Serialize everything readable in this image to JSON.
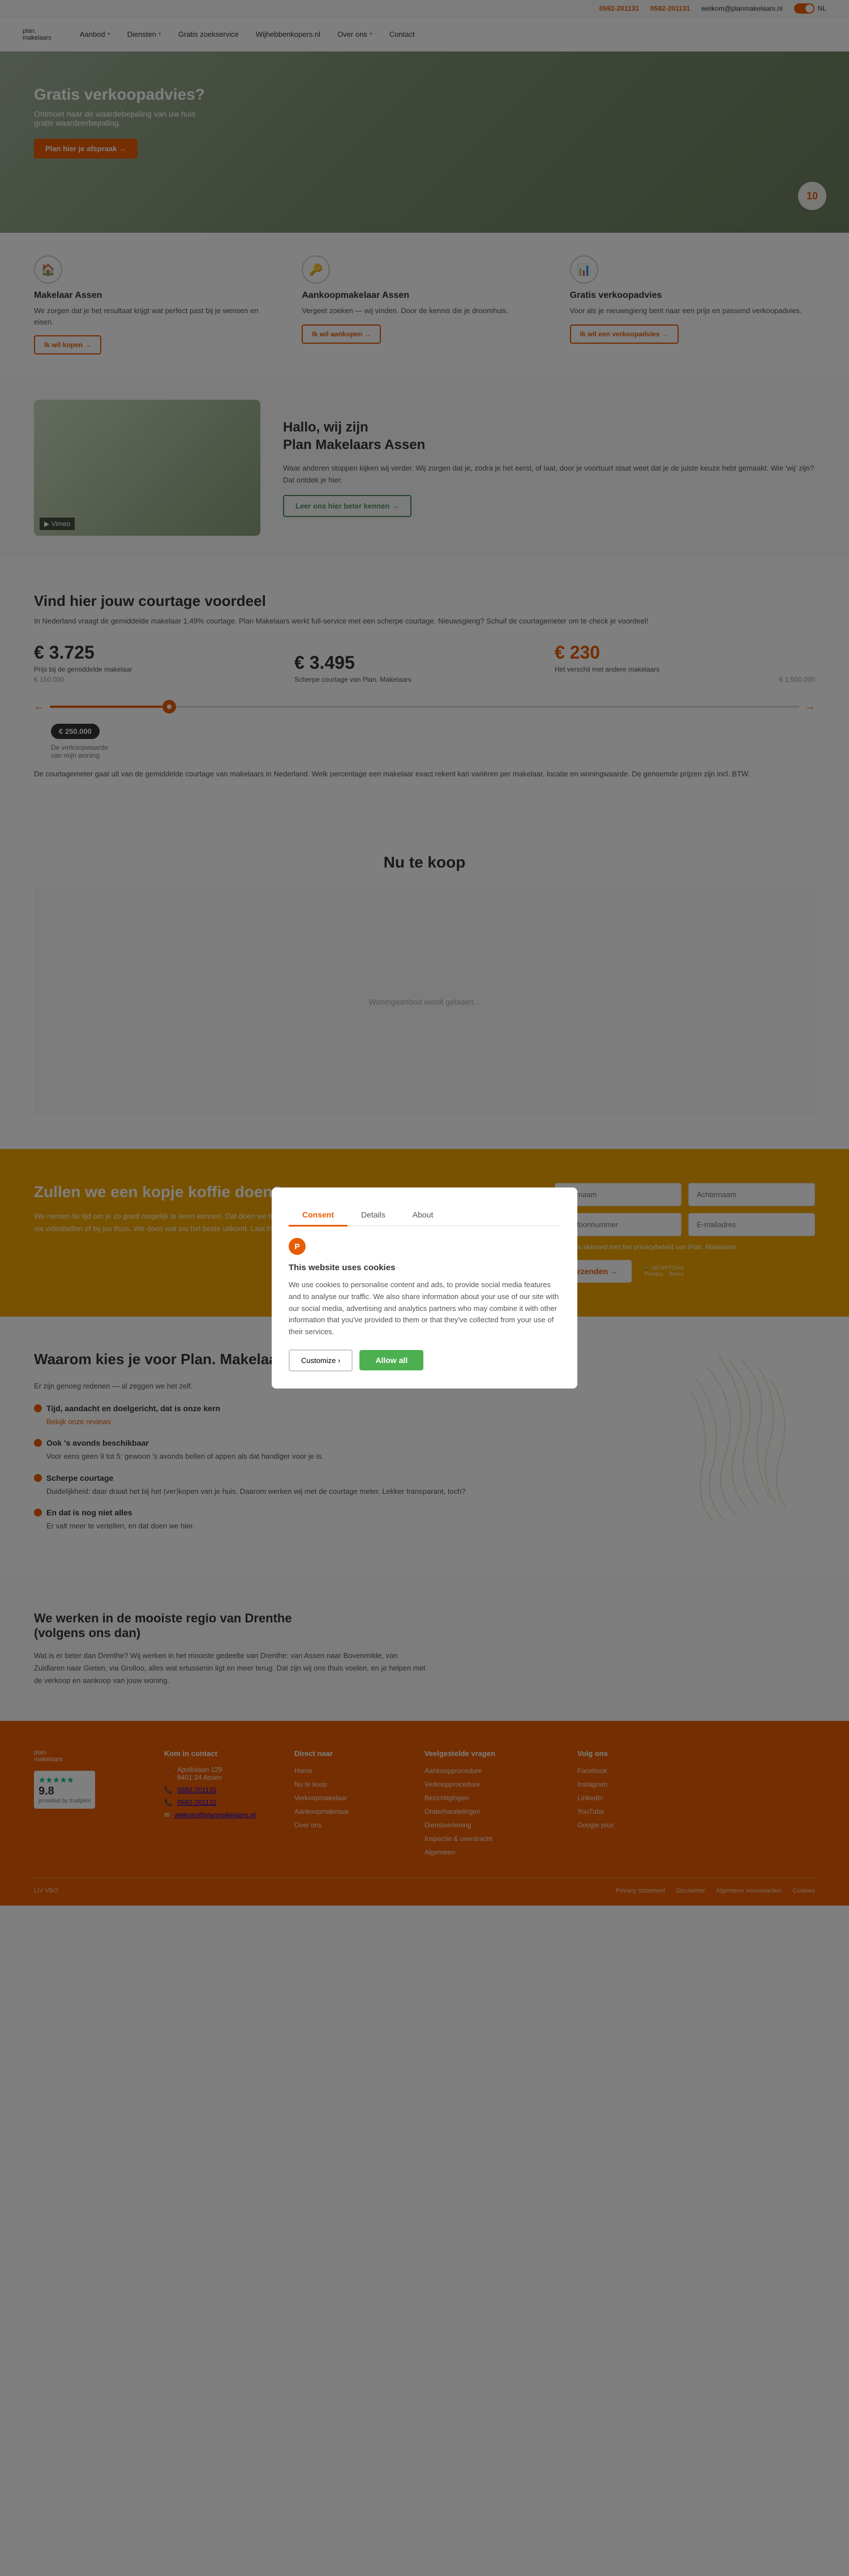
{
  "topbar": {
    "phone1": "0592-201131",
    "phone2": "0592-201131",
    "email": "welkom@planmakelaars.nl",
    "toggle_label": "NL"
  },
  "nav": {
    "logo": "plan.",
    "logo_sub": "makelaars",
    "items": [
      {
        "label": "Aanbod",
        "has_dropdown": true
      },
      {
        "label": "Diensten",
        "has_dropdown": true
      },
      {
        "label": "Gratis zoekservice",
        "has_dropdown": false
      },
      {
        "label": "Wijhebbenkopers.nl",
        "has_dropdown": false
      },
      {
        "label": "Over ons",
        "has_dropdown": true
      },
      {
        "label": "Contact",
        "has_dropdown": false
      }
    ]
  },
  "hero": {
    "title": "Gratis verkoopadvies?",
    "description": "Ontmoet naar de waardebepaling van uw huis gratis waardeerbepaling.",
    "cta": "Plan hier je afspraak →",
    "number": "10"
  },
  "cookie_modal": {
    "tabs": [
      "Consent",
      "Details",
      "About"
    ],
    "active_tab": "Consent",
    "logo_letter": "P",
    "title": "This website uses cookies",
    "description": "We use cookies to personalise content and ads, to provide social media features and to analyse our traffic. We also share information about your use of our site with our social media, advertising and analytics partners who may combine it with other information that you've provided to them or that they've collected from your use of their services.",
    "customize_label": "Customize ›",
    "allow_all_label": "Allow all"
  },
  "cards": [
    {
      "icon": "🏠",
      "title": "Makelaar Assen",
      "description": "We zorgen dat je het resultaat krijgt wat perfect past bij je wensen en eisen.",
      "cta": "Ik wil kopen →"
    },
    {
      "icon": "🔑",
      "title": "Aankoopmakelaar Assen",
      "description": "Vergeet zoeken — wij vinden. Door de kennis die je droomhuis.",
      "cta": "Ik wil aankopen →"
    },
    {
      "icon": "📊",
      "title": "Gratis verkoopadvies",
      "description": "Voor als je nieuwsgierig bent naar een prijs en passend verkoopadvies.",
      "cta": "Ik wil een verkoopadvies →"
    }
  ],
  "video_section": {
    "title": "Hallo, wij zijn\nPlan Makelaars Assen",
    "description": "Waar anderen stoppen kijken wij verder. Wij zorgen dat je, zodra je het eerst, of laat, door je voortuurt staat weet dat je de juiste keuze hebt gemaakt. Wie 'wij' zijn? Dat ontdek je hier.",
    "cta": "Leer ons hier beter kennen →"
  },
  "courtage": {
    "title": "Vind hier jouw courtage voordeel",
    "description": "In Nederland vraagt de gemiddelde makelaar 1,49% courtage. Plan Makelaars werkt full-service met een scherpe courtage. Nieuwsgierig? Schuif de courtagemeter om te check je voordeel!",
    "price_avg": "€ 3.725",
    "price_avg_label": "Prijs bij de gemiddelde makelaar",
    "price_plan": "€ 3.495",
    "price_plan_label": "Scherpe courtage van Plan. Makelaars",
    "price_diff": "€ 230",
    "price_diff_label": "Het verschil met andere makelaars",
    "slider_min": "€ 150.000",
    "slider_max": "€ 1.500.000",
    "home_value": "€ 250.000",
    "home_value_label": "De verkoopwaarde\nvan mijn woning",
    "note": "De courtagemeter gaat uit van de gemiddelde courtage van makelaars in Nederland. Welk percentage een makelaar exact rekent kan variëren per makelaar, locatie en woningwaarde. De genoemde prijzen zijn incl. BTW."
  },
  "nu_koop": {
    "title": "Nu te koop"
  },
  "koffie": {
    "title": "Zullen we een kopje koffie doen?",
    "description": "We nemen de tijd om je zo goed mogelijk te leren kennen. Dat doen we tijdens een vrijblijvend kennismakingsgesprek. Dit kan 's avonds, overdag, via videobellen of bij jou thuis. We doen wat jou het beste uitkomt. Laat hier je gegevens achter. Wij doen de rest →",
    "form": {
      "firstname_placeholder": "Voornaam",
      "lastname_placeholder": "Achternaam",
      "phone_placeholder": "Telefoonnummer",
      "email_placeholder": "E-mailadres",
      "privacy_label": "Ik ga akkoord met het privacybeleid van Plan. Makelaars",
      "submit_label": "Verzenden →"
    }
  },
  "waarom": {
    "title": "Waarom kies je voor Plan. Makelaars?",
    "subtitle": "Er zijn genoeg redenen — al zeggen we het zelf.",
    "items": [
      {
        "title": "Tijd, aandacht en doelgericht, dat is onze kern",
        "subtitle_link": "Bekijk onze reviews",
        "description": ""
      },
      {
        "title": "Ook 's avonds beschikbaar",
        "description": "Voor eens geen 9 tot 5: gewoon 's avonds bellen of appen als dat handiger voor je is."
      },
      {
        "title": "Scherpe courtage",
        "description": "Duidelijkheid: daar draait het bij het (ver)kopen van je huis. Daarom werken wij met de courtage meter. Lekker transparant, toch?"
      },
      {
        "title": "En dat is nog niet alles",
        "description": "Er valt meer te vertellen, en dat doen we hier."
      }
    ]
  },
  "regio": {
    "title": "We werken in de mooiste regio van Drenthe\n(volgens ons dan)",
    "description": "Wat is er beter dan Drenthe? Wij werken in het mooiste gedeelte van Drenthe: van Assen naar Bovenmilde, van Zuidlaren naar Gieten, via Grolloo, alles wat ertussenin ligt en meer terug. Dat zijn wij ons thuis voelen, en je helpen met de verkoop en aankoop van jouw woning."
  },
  "footer": {
    "logo": "plan.",
    "logo_sub": "makelaars",
    "trust_score": "9.8",
    "trust_label": "provided by trustpilot",
    "cols": [
      {
        "title": "Kom in contact",
        "items": [
          "Apollolaan 129",
          "9401 24 Assen",
          "0592-201131",
          "0592-201131",
          "welkom@planmakelaars.nl"
        ]
      },
      {
        "title": "Direct naar",
        "links": [
          "Home",
          "Nu te koop",
          "Verkoopmakelaar",
          "Aankoopmakelaar",
          "Over ons"
        ]
      },
      {
        "title": "Veelgestelde vragen",
        "links": [
          "Aankoopprocedure",
          "Verkoopprocedure",
          "Bezichtigingen",
          "Onderhandelingen",
          "Dienstverlening",
          "Inspectie & overdracht",
          "Algemeen"
        ]
      },
      {
        "title": "Volg ons",
        "links": [
          "Facebook",
          "Instagram",
          "LinkedIn",
          "YouTube",
          "Google plus"
        ]
      }
    ],
    "bottom": {
      "left": "LIV VBO",
      "links": [
        "Privacy statement",
        "Disclaimer",
        "Algemene voorwaarden",
        "Cookies"
      ]
    }
  }
}
